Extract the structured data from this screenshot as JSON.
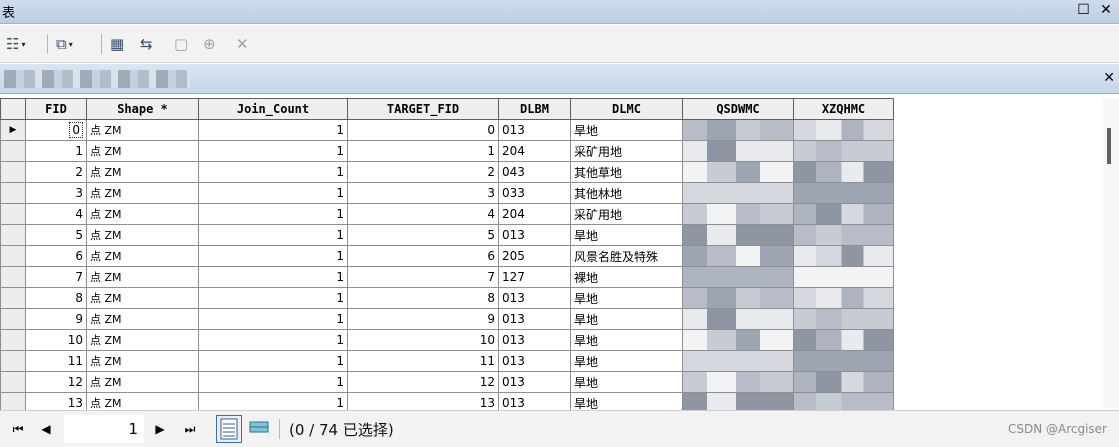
{
  "window": {
    "title": "表",
    "restore_label": "☐",
    "close_label": "✕"
  },
  "toolbar": {
    "table_options": "☷",
    "related_tables": "⧉",
    "select_by_attributes": "▦",
    "switch_selection": "⇆",
    "clear_selection": "▢",
    "zoom_selected": "⊕",
    "delete_selected": "✕",
    "dropdown_arrow": "▾"
  },
  "tab": {
    "close_label": "✕"
  },
  "grid": {
    "columns": [
      "FID",
      "Shape *",
      "Join_Count",
      "TARGET_FID",
      "DLBM",
      "DLMC",
      "QSDWMC",
      "XZQHMC"
    ],
    "row_indicator": "▶",
    "rows": [
      {
        "fid": "0",
        "shape": "点 ZM",
        "join_count": "1",
        "target_fid": "0",
        "dlbm": "013",
        "dlmc": "旱地"
      },
      {
        "fid": "1",
        "shape": "点 ZM",
        "join_count": "1",
        "target_fid": "1",
        "dlbm": "204",
        "dlmc": "采矿用地"
      },
      {
        "fid": "2",
        "shape": "点 ZM",
        "join_count": "1",
        "target_fid": "2",
        "dlbm": "043",
        "dlmc": "其他草地"
      },
      {
        "fid": "3",
        "shape": "点 ZM",
        "join_count": "1",
        "target_fid": "3",
        "dlbm": "033",
        "dlmc": "其他林地"
      },
      {
        "fid": "4",
        "shape": "点 ZM",
        "join_count": "1",
        "target_fid": "4",
        "dlbm": "204",
        "dlmc": "采矿用地"
      },
      {
        "fid": "5",
        "shape": "点 ZM",
        "join_count": "1",
        "target_fid": "5",
        "dlbm": "013",
        "dlmc": "旱地"
      },
      {
        "fid": "6",
        "shape": "点 ZM",
        "join_count": "1",
        "target_fid": "6",
        "dlbm": "205",
        "dlmc": "风景名胜及特殊"
      },
      {
        "fid": "7",
        "shape": "点 ZM",
        "join_count": "1",
        "target_fid": "7",
        "dlbm": "127",
        "dlmc": "裸地"
      },
      {
        "fid": "8",
        "shape": "点 ZM",
        "join_count": "1",
        "target_fid": "8",
        "dlbm": "013",
        "dlmc": "旱地"
      },
      {
        "fid": "9",
        "shape": "点 ZM",
        "join_count": "1",
        "target_fid": "9",
        "dlbm": "013",
        "dlmc": "旱地"
      },
      {
        "fid": "10",
        "shape": "点 ZM",
        "join_count": "1",
        "target_fid": "10",
        "dlbm": "013",
        "dlmc": "旱地"
      },
      {
        "fid": "11",
        "shape": "点 ZM",
        "join_count": "1",
        "target_fid": "11",
        "dlbm": "013",
        "dlmc": "旱地"
      },
      {
        "fid": "12",
        "shape": "点 ZM",
        "join_count": "1",
        "target_fid": "12",
        "dlbm": "013",
        "dlmc": "旱地"
      },
      {
        "fid": "13",
        "shape": "点 ZM",
        "join_count": "1",
        "target_fid": "13",
        "dlbm": "013",
        "dlmc": "旱地"
      }
    ]
  },
  "statusbar": {
    "first_label": "⏮",
    "prev_label": "◀",
    "next_label": "▶",
    "last_label": "⏭",
    "current_record": "1",
    "selection_text": "(0 / 74 已选择)",
    "watermark": "CSDN @Arcgiser"
  }
}
